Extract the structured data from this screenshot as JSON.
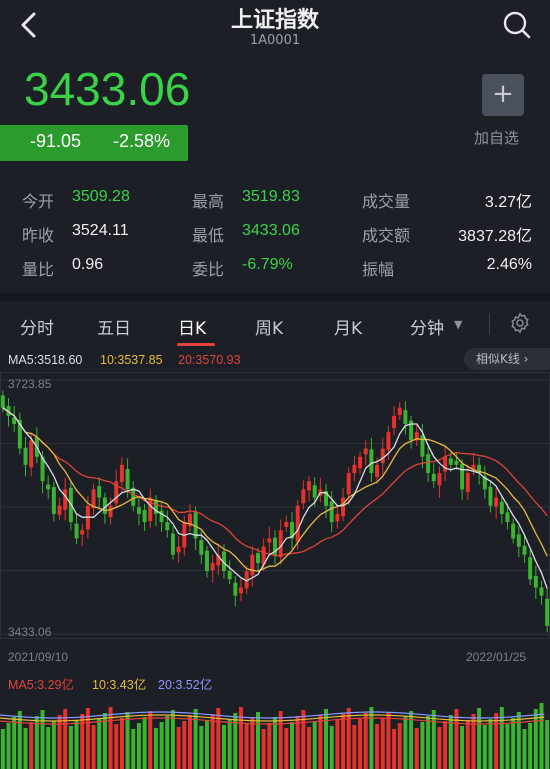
{
  "header": {
    "title": "上证指数",
    "code": "1A0001"
  },
  "quote": {
    "price": "3433.06",
    "change": "-91.05",
    "change_pct": "-2.58%",
    "add_label": "加自选",
    "add_symbol": "+"
  },
  "stats": [
    {
      "label": "今开",
      "value": "3509.28",
      "color": "green"
    },
    {
      "label": "昨收",
      "value": "3524.11",
      "color": "white"
    },
    {
      "label": "量比",
      "value": "0.96",
      "color": "white"
    },
    {
      "label": "最高",
      "value": "3519.83",
      "color": "green"
    },
    {
      "label": "最低",
      "value": "3433.06",
      "color": "green"
    },
    {
      "label": "委比",
      "value": "-6.79%",
      "color": "green"
    },
    {
      "label": "成交量",
      "value": "3.27亿",
      "color": "white"
    },
    {
      "label": "成交额",
      "value": "3837.28亿",
      "color": "white"
    },
    {
      "label": "振幅",
      "value": "2.46%",
      "color": "white"
    }
  ],
  "tabs": [
    "分时",
    "五日",
    "日K",
    "周K",
    "月K",
    "分钟"
  ],
  "active_tab": "日K",
  "ma_legend": {
    "ma5": "MA5:3518.60",
    "ma10": "10:3537.85",
    "ma20": "20:3570.93"
  },
  "similar_k_label": "相似K线 ›",
  "axis": {
    "high_label": "3723.85",
    "low_label": "3433.06",
    "start_date": "2021/09/10",
    "end_date": "2022/01/25"
  },
  "vol_legend": {
    "ma5": "MA5:3.29亿",
    "ma10": "10:3.43亿",
    "ma20": "20:3.52亿"
  },
  "colors": {
    "up": "#e5332b",
    "down": "#39b52e",
    "ma5": "#d9dde4",
    "ma10": "#e8b93b",
    "ma20": "#e0443a",
    "ma20vol": "#8a98ff"
  },
  "chart_data": {
    "type": "candlestick",
    "ylim": [
      3433.06,
      3723.85
    ],
    "x_start": "2021/09/10",
    "x_end": "2022/01/25",
    "closes": [
      3700,
      3690,
      3680,
      3650,
      3630,
      3660,
      3640,
      3610,
      3600,
      3570,
      3580,
      3600,
      3560,
      3540,
      3550,
      3580,
      3600,
      3590,
      3570,
      3580,
      3610,
      3630,
      3600,
      3580,
      3570,
      3560,
      3590,
      3570,
      3560,
      3550,
      3520,
      3530,
      3560,
      3570,
      3540,
      3520,
      3500,
      3510,
      3520,
      3500,
      3490,
      3470,
      3480,
      3500,
      3520,
      3510,
      3530,
      3540,
      3520,
      3550,
      3560,
      3540,
      3580,
      3600,
      3610,
      3590,
      3600,
      3580,
      3560,
      3570,
      3590,
      3620,
      3630,
      3640,
      3650,
      3620,
      3630,
      3650,
      3670,
      3690,
      3700,
      3680,
      3660,
      3670,
      3640,
      3620,
      3610,
      3620,
      3640,
      3630,
      3630,
      3600,
      3620,
      3630,
      3620,
      3600,
      3580,
      3590,
      3570,
      3560,
      3540,
      3530,
      3520,
      3490,
      3480,
      3470,
      3433
    ]
  }
}
